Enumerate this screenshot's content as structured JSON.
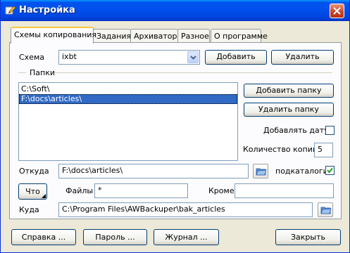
{
  "window": {
    "title": "Настройка"
  },
  "tabs": [
    {
      "label": "Схемы копирования",
      "active": true
    },
    {
      "label": "Задания",
      "active": false
    },
    {
      "label": "Архиватор",
      "active": false
    },
    {
      "label": "Разное",
      "active": false
    },
    {
      "label": "О программе",
      "active": false
    }
  ],
  "scheme": {
    "label": "Схема",
    "value": "ixbt",
    "add_button": "Добавить",
    "delete_button": "Удалить"
  },
  "folders": {
    "group_label": "Папки",
    "items": [
      {
        "path": "C:\\Soft\\",
        "selected": false
      },
      {
        "path": "F:\\docs\\articles\\",
        "selected": true
      }
    ],
    "add_button": "Добавить папку",
    "delete_button": "Удалить папку",
    "add_date_label": "Добавлять дату",
    "add_date_checked": false,
    "copies_label": "Количество копий",
    "copies_value": "5"
  },
  "source": {
    "label": "Откуда",
    "value": "F:\\docs\\articles\\",
    "subfolders_label": "подкаталоги",
    "subfolders_checked": true
  },
  "filter": {
    "what_button": "Что",
    "files_label": "Файлы",
    "files_value": "*",
    "except_label": "Кроме",
    "except_value": ""
  },
  "destination": {
    "label": "Куда",
    "value": "C:\\Program Files\\AWBackuper\\bak_articles"
  },
  "footer": {
    "help": "Справка ...",
    "password": "Пароль ...",
    "log": "Журнал ...",
    "close": "Закрыть"
  },
  "colors": {
    "titlebar": "#0054e3",
    "selection": "#316ac5",
    "checkmark": "#21a121",
    "tab_highlight": "#ffc83c"
  }
}
